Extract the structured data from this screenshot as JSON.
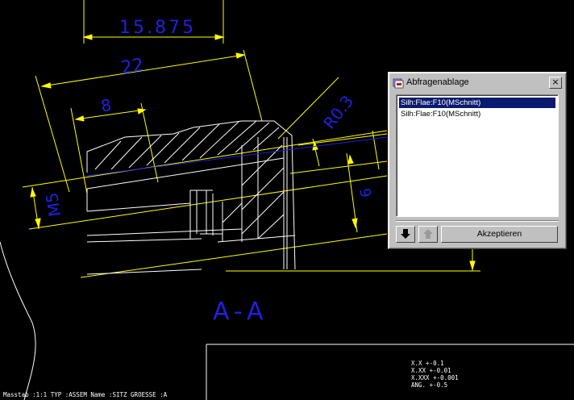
{
  "drawing": {
    "dimensions": {
      "top": "15.875",
      "overall": "22",
      "inner": "8",
      "radius": "R0.3",
      "thread": "M5",
      "height": "6"
    },
    "section_label": "A-A",
    "title_block": {
      "tolerance_lines": [
        "X.X    +-0.1",
        "X.XX   +-0.01",
        "X.XXX  +-0.001",
        "ANG.   +-0.5"
      ],
      "footer": "Masstab :1:1     TYP :ASSEM  Name :SITZ  GROESSE :A"
    }
  },
  "dialog": {
    "title": "Abfragenablage",
    "items": [
      "Silh:Flae:F10(MSchnitt)",
      "Silh:Flae:F10(MSchnitt)"
    ],
    "selected_index": 0,
    "close_label": "×",
    "accept_label": "Akzeptieren",
    "down_icon": "arrow-down-icon",
    "up_icon": "arrow-up-icon"
  },
  "colors": {
    "background": "#000000",
    "geometry": "#ffffff",
    "dimension": "#ffff00",
    "dimension_text": "#2020e0",
    "selection": "#0a1a6e"
  }
}
